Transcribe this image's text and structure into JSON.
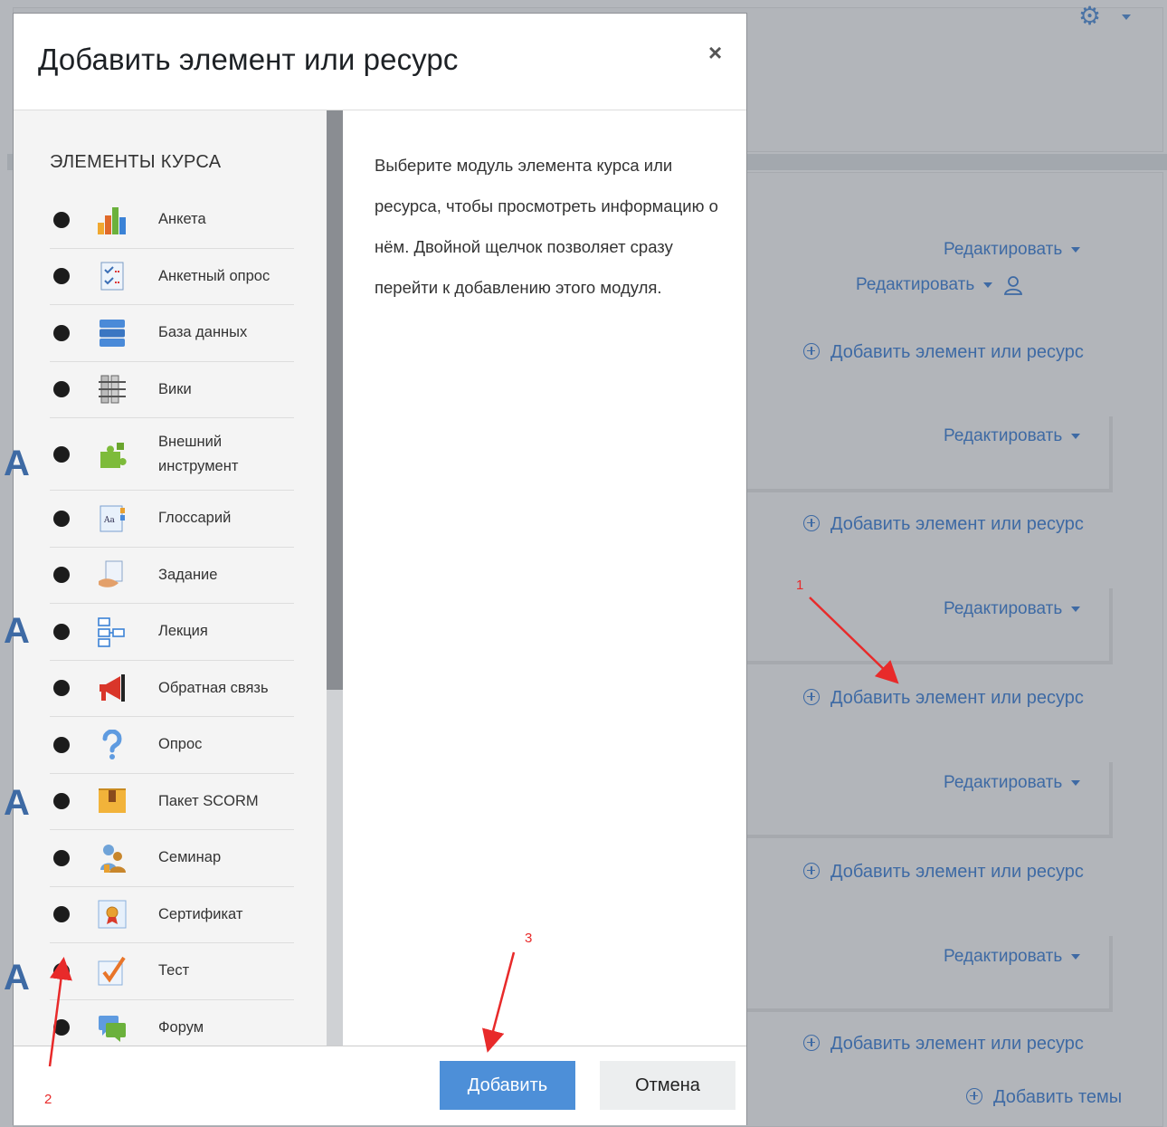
{
  "modal": {
    "title": "Добавить элемент или ресурс",
    "close_glyph": "×",
    "list_heading": "ЭЛЕМЕНТЫ КУРСА",
    "items": [
      {
        "label": "Анкета",
        "icon": "bar-chart-icon"
      },
      {
        "label": "Анкетный опрос",
        "icon": "checklist-icon"
      },
      {
        "label": "База данных",
        "icon": "database-icon"
      },
      {
        "label": "Вики",
        "icon": "wiki-icon"
      },
      {
        "label": "Внешний инструмент",
        "icon": "puzzle-icon"
      },
      {
        "label": "Глоссарий",
        "icon": "glossary-icon"
      },
      {
        "label": "Задание",
        "icon": "assignment-icon"
      },
      {
        "label": "Лекция",
        "icon": "lesson-icon"
      },
      {
        "label": "Обратная связь",
        "icon": "megaphone-icon"
      },
      {
        "label": "Опрос",
        "icon": "question-icon"
      },
      {
        "label": "Пакет SCORM",
        "icon": "package-icon"
      },
      {
        "label": "Семинар",
        "icon": "workshop-icon"
      },
      {
        "label": "Сертификат",
        "icon": "certificate-icon"
      },
      {
        "label": "Тест",
        "icon": "quiz-icon"
      },
      {
        "label": "Форум",
        "icon": "forum-icon"
      }
    ],
    "description": "Выберите модуль элемента курса или ресурса, чтобы просмотреть информацию о нём. Двойной щелчок позволяет сразу перейти к добавлению этого модуля.",
    "add_button": "Добавить",
    "cancel_button": "Отмена"
  },
  "background": {
    "edit_label": "Редактировать",
    "add_activity_label": "Добавить элемент или ресурс",
    "add_topics_label": "Добавить темы",
    "gear_glyph": "⚙"
  },
  "annotations": {
    "n1": "1",
    "n2": "2",
    "n3": "3"
  },
  "colors": {
    "link": "#3e6aa4",
    "primary_button": "#4d8fd8",
    "annotation": "#e82a2a"
  }
}
